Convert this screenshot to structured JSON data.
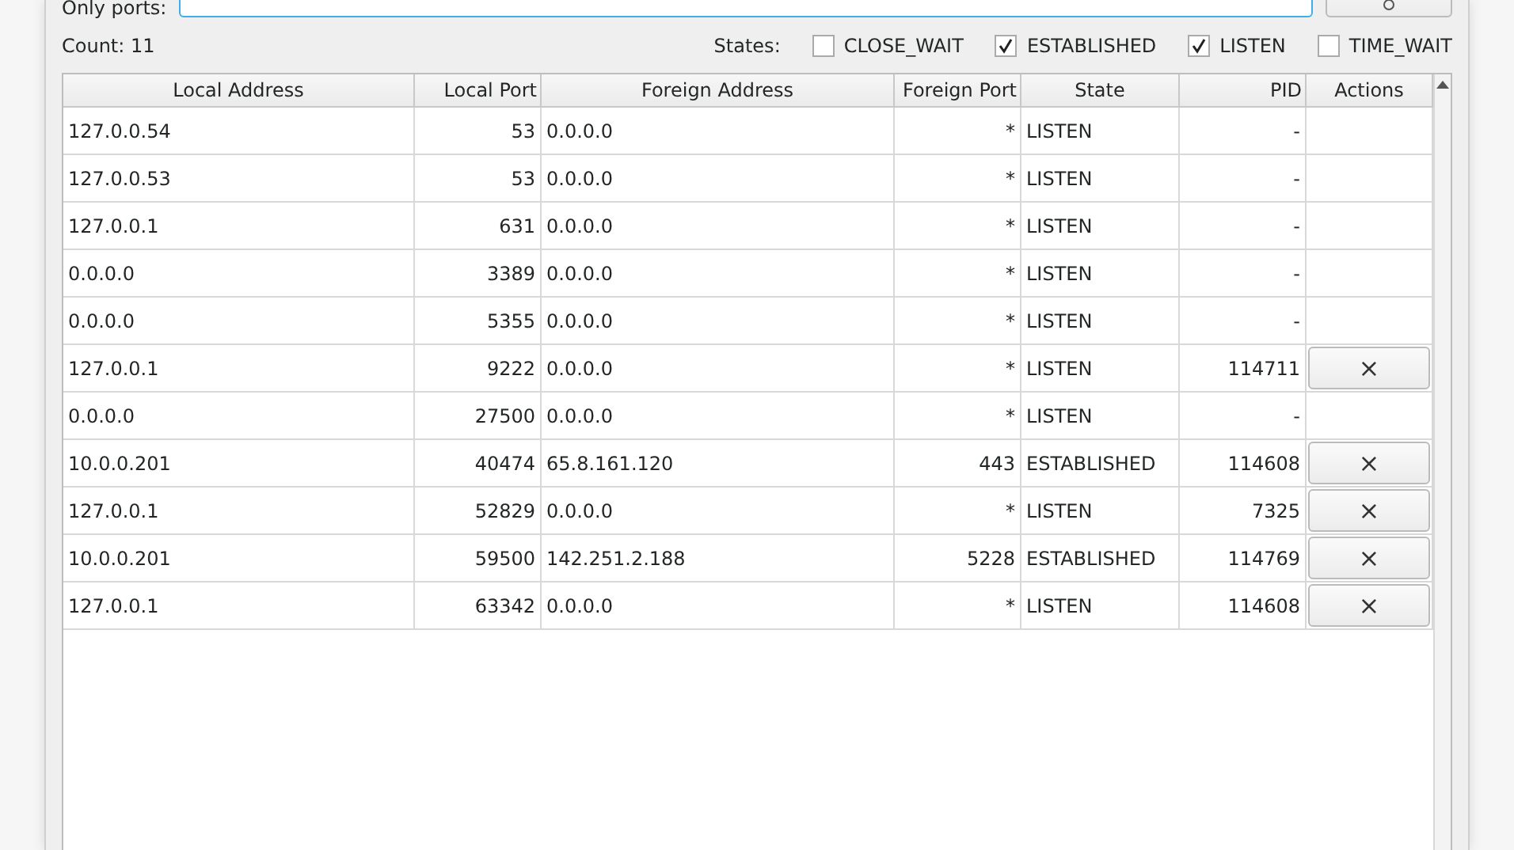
{
  "filter": {
    "label": "Only ports:"
  },
  "count": "Count: 11",
  "states": {
    "label": "States:",
    "options": [
      {
        "label": "CLOSE_WAIT",
        "checked": false
      },
      {
        "label": "ESTABLISHED",
        "checked": true
      },
      {
        "label": "LISTEN",
        "checked": true
      },
      {
        "label": "TIME_WAIT",
        "checked": false
      }
    ]
  },
  "table": {
    "columns": [
      "Local Address",
      "Local Port",
      "Foreign Address",
      "Foreign Port",
      "State",
      "PID",
      "Actions"
    ],
    "rows": [
      {
        "local_address": "127.0.0.54",
        "local_port": "53",
        "foreign_address": "0.0.0.0",
        "foreign_port": "*",
        "state": "LISTEN",
        "pid": "-"
      },
      {
        "local_address": "127.0.0.53",
        "local_port": "53",
        "foreign_address": "0.0.0.0",
        "foreign_port": "*",
        "state": "LISTEN",
        "pid": "-"
      },
      {
        "local_address": "127.0.0.1",
        "local_port": "631",
        "foreign_address": "0.0.0.0",
        "foreign_port": "*",
        "state": "LISTEN",
        "pid": "-"
      },
      {
        "local_address": "0.0.0.0",
        "local_port": "3389",
        "foreign_address": "0.0.0.0",
        "foreign_port": "*",
        "state": "LISTEN",
        "pid": "-"
      },
      {
        "local_address": "0.0.0.0",
        "local_port": "5355",
        "foreign_address": "0.0.0.0",
        "foreign_port": "*",
        "state": "LISTEN",
        "pid": "-"
      },
      {
        "local_address": "127.0.0.1",
        "local_port": "9222",
        "foreign_address": "0.0.0.0",
        "foreign_port": "*",
        "state": "LISTEN",
        "pid": "114711",
        "action": "×"
      },
      {
        "local_address": "0.0.0.0",
        "local_port": "27500",
        "foreign_address": "0.0.0.0",
        "foreign_port": "*",
        "state": "LISTEN",
        "pid": "-"
      },
      {
        "local_address": "10.0.0.201",
        "local_port": "40474",
        "foreign_address": "65.8.161.120",
        "foreign_port": "443",
        "state": "ESTABLISHED",
        "pid": "114608",
        "action": "×"
      },
      {
        "local_address": "127.0.0.1",
        "local_port": "52829",
        "foreign_address": "0.0.0.0",
        "foreign_port": "*",
        "state": "LISTEN",
        "pid": "7325",
        "action": "×"
      },
      {
        "local_address": "10.0.0.201",
        "local_port": "59500",
        "foreign_address": "142.251.2.188",
        "foreign_port": "5228",
        "state": "ESTABLISHED",
        "pid": "114769",
        "action": "×"
      },
      {
        "local_address": "127.0.0.1",
        "local_port": "63342",
        "foreign_address": "0.0.0.0",
        "foreign_port": "*",
        "state": "LISTEN",
        "pid": "114608",
        "action": "×"
      }
    ]
  }
}
